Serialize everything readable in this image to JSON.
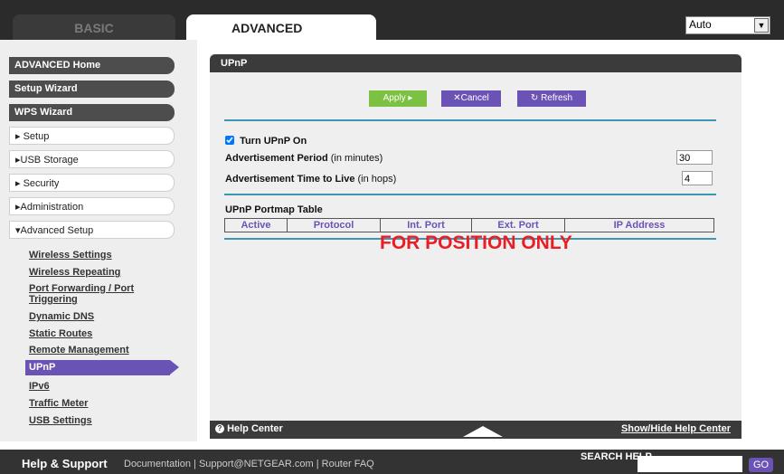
{
  "tabs": {
    "basic": "BASIC",
    "advanced": "ADVANCED"
  },
  "language_select": {
    "value": "Auto"
  },
  "sidebar": {
    "dark_items": [
      "ADVANCED Home",
      "Setup Wizard",
      "WPS Wizard"
    ],
    "light_items": [
      "▸ Setup",
      "▸USB Storage",
      "▸ Security",
      "▸Administration",
      "▾Advanced Setup"
    ],
    "sub_items": [
      "Wireless Settings",
      "Wireless Repeating",
      "Port Forwarding / Port Triggering",
      "Dynamic DNS",
      "Static Routes",
      "Remote Management",
      "UPnP",
      "IPv6",
      "Traffic Meter",
      "USB Settings"
    ]
  },
  "main": {
    "title": "UPnP",
    "buttons": {
      "apply": "Apply ▸",
      "cancel": "✕Cancel",
      "refresh": "↻ Refresh"
    },
    "turn_on_label": "Turn UPnP On",
    "turn_on_checked": true,
    "adv_period_label": "Advertisement Period",
    "adv_period_unit": "(in minutes)",
    "adv_period_value": "30",
    "adv_ttl_label": "Advertisement Time to Live",
    "adv_ttl_unit": "(in hops)",
    "adv_ttl_value": "4",
    "portmap_title": "UPnP Portmap Table",
    "portmap_columns": [
      "Active",
      "Protocol",
      "Int. Port",
      "Ext. Port",
      "IP Address"
    ],
    "watermark": "FOR POSITION ONLY",
    "help_center": "Help Center",
    "show_hide": "Show/Hide Help Center"
  },
  "footer": {
    "help_support": "Help & Support",
    "links": "Documentation | Support@NETGEAR.com | Router FAQ",
    "search_label": "SEARCH HELP",
    "go": "GO"
  },
  "colors": {
    "accent_purple": "#6b53b5",
    "accent_blue": "#3c98b2",
    "apply_green": "#7cc142",
    "watermark_red": "#ea1d25"
  }
}
